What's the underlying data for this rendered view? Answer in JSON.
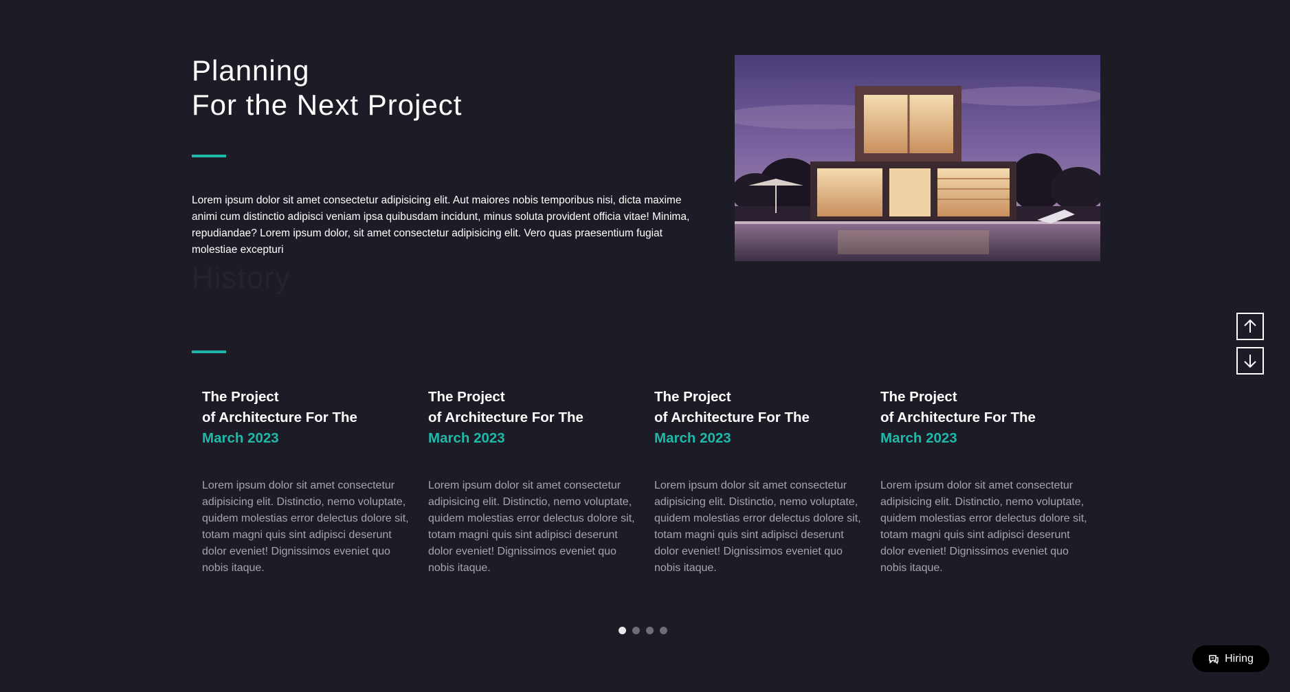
{
  "hero": {
    "title_line1": "Planning",
    "title_line2": "For the Next Project",
    "intro": "Lorem ipsum dolor sit amet consectetur adipisicing elit. Aut maiores nobis temporibus nisi, dicta maxime animi cum distinctio adipisci veniam ipsa quibusdam incidunt, minus soluta provident officia vitae! Minima, repudiandae? Lorem ipsum dolor, sit amet consectetur adipisicing elit. Vero quas praesentium fugiat molestiae excepturi"
  },
  "history": {
    "title": "History"
  },
  "cards": [
    {
      "line1": "The Project",
      "line2": "of Architecture For The",
      "date": "March 2023",
      "body": "Lorem ipsum dolor sit amet consectetur adipisicing elit. Distinctio, nemo voluptate, quidem molestias error delectus dolore sit, totam magni quis sint adipisci deserunt dolor eveniet! Dignissimos eveniet quo nobis itaque."
    },
    {
      "line1": "The Project",
      "line2": "of Architecture For The",
      "date": "March 2023",
      "body": "Lorem ipsum dolor sit amet consectetur adipisicing elit. Distinctio, nemo voluptate, quidem molestias error delectus dolore sit, totam magni quis sint adipisci deserunt dolor eveniet! Dignissimos eveniet quo nobis itaque."
    },
    {
      "line1": "The Project",
      "line2": "of Architecture For The",
      "date": "March 2023",
      "body": "Lorem ipsum dolor sit amet consectetur adipisicing elit. Distinctio, nemo voluptate, quidem molestias error delectus dolore sit, totam magni quis sint adipisci deserunt dolor eveniet! Dignissimos eveniet quo nobis itaque."
    },
    {
      "line1": "The Project",
      "line2": "of Architecture For The",
      "date": "March 2023",
      "body": "Lorem ipsum dolor sit amet consectetur adipisicing elit. Distinctio, nemo voluptate, quidem molestias error delectus dolore sit, totam magni quis sint adipisci deserunt dolor eveniet! Dignissimos eveniet quo nobis itaque."
    }
  ],
  "carousel": {
    "dot_count": 4,
    "active_index": 0
  },
  "nav": {
    "up_icon": "arrow-up-icon",
    "down_icon": "arrow-down-icon"
  },
  "hiring": {
    "label": "Hiring",
    "icon": "chat-icon"
  },
  "colors": {
    "background": "#1d1c26",
    "accent": "#1fb9a9",
    "text": "#ffffff",
    "muted_text": "#a6a5ad"
  }
}
